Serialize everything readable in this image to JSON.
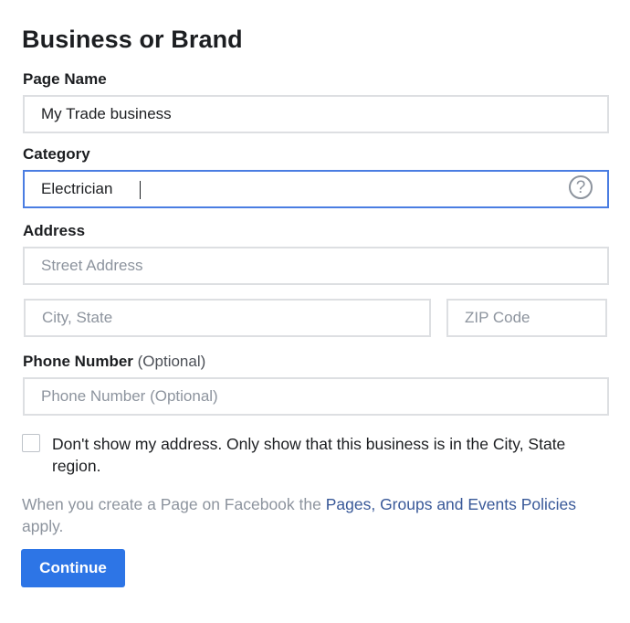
{
  "heading": "Business or Brand",
  "page_name": {
    "label": "Page Name",
    "value": "My Trade business"
  },
  "category": {
    "label": "Category",
    "value": "Electrician",
    "help_icon": "?"
  },
  "address": {
    "label": "Address",
    "street_placeholder": "Street Address",
    "city_placeholder": "City, State",
    "zip_placeholder": "ZIP Code"
  },
  "phone": {
    "label": "Phone Number",
    "optional_note": "(Optional)",
    "placeholder": "Phone Number (Optional)"
  },
  "hide_address": {
    "checked": false,
    "text": "Don't show my address. Only show that this business is in the City, State region."
  },
  "policy": {
    "prefix": "When you create a Page on Facebook the ",
    "link": "Pages, Groups and Events Policies",
    "suffix": " apply."
  },
  "continue_label": "Continue",
  "colors": {
    "accent": "#2d75e6",
    "link": "#385898",
    "focus_border": "#4a7de2",
    "placeholder": "#8d949e"
  }
}
